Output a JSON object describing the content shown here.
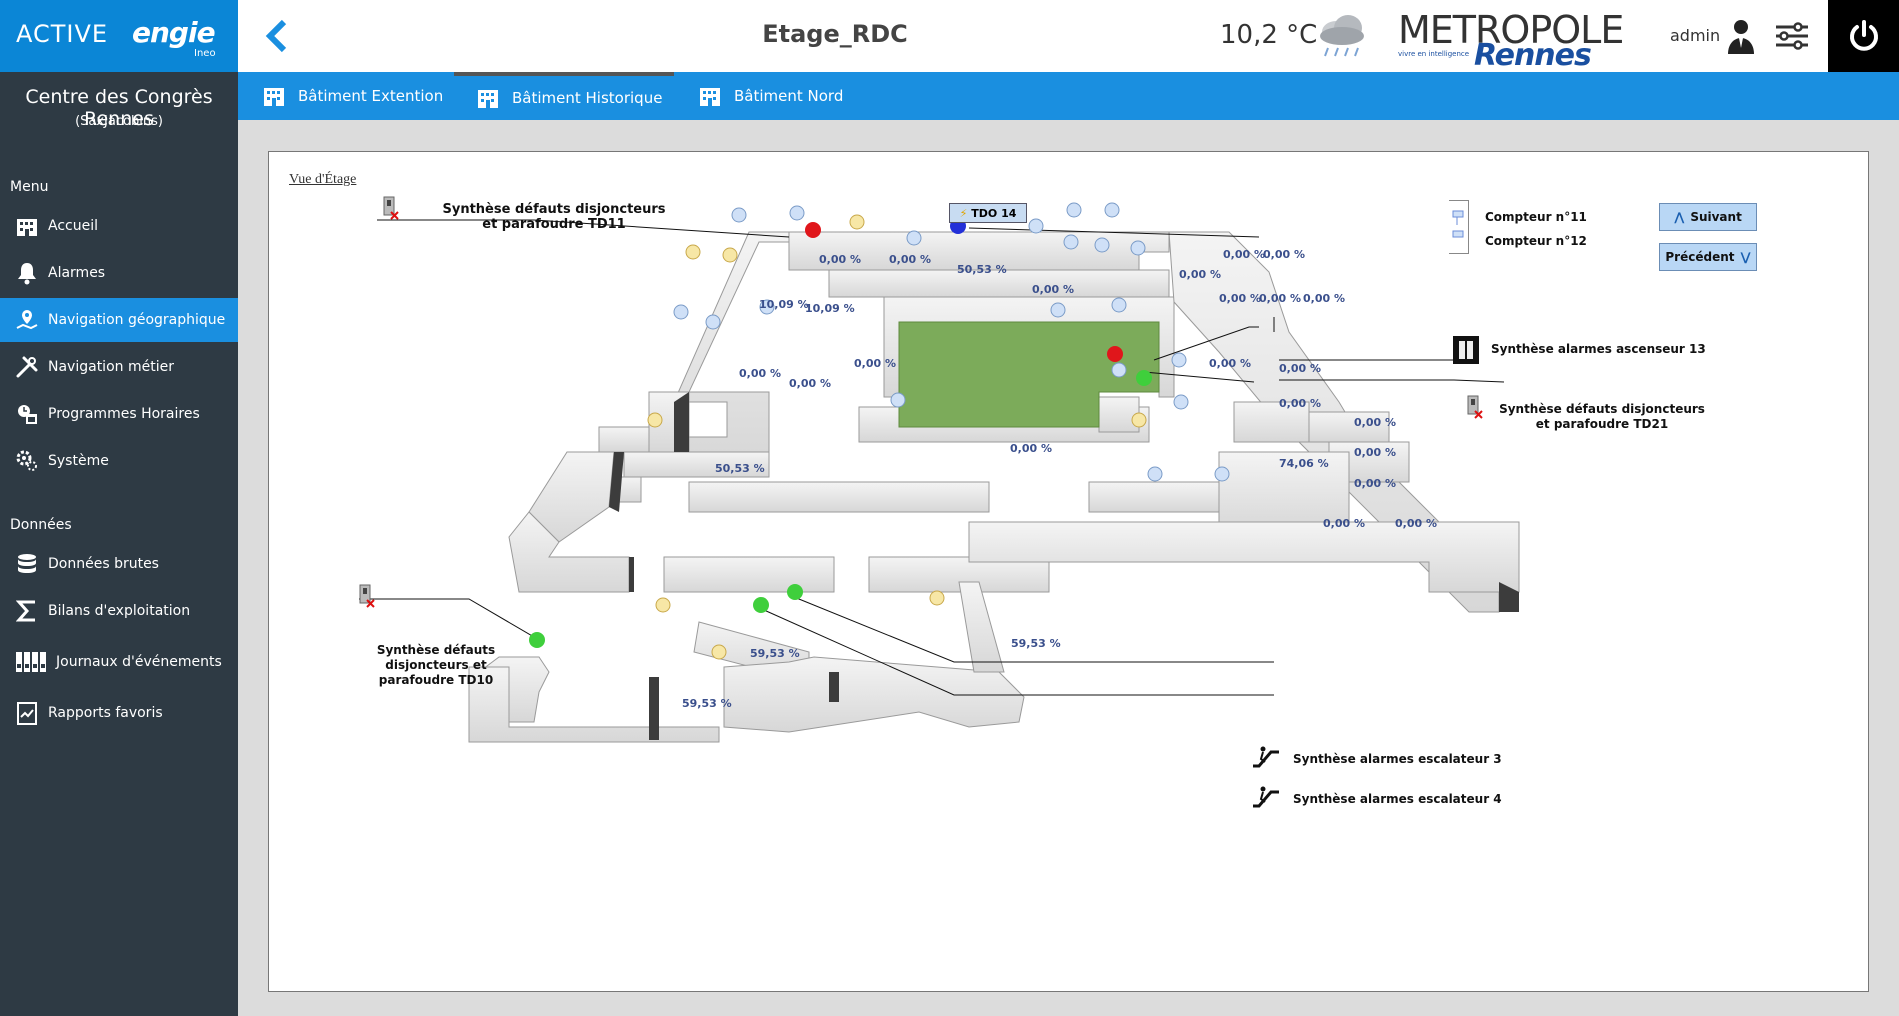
{
  "brand": {
    "active": "ACTIVE",
    "engie": "engie",
    "ineo": "Ineo"
  },
  "site": {
    "name": "Centre des Congrès Rennes",
    "sub": "(SaxJacobins)"
  },
  "sidebar": {
    "menu_title": "Menu",
    "menu": [
      {
        "label": "Accueil",
        "icon": "building-icon"
      },
      {
        "label": "Alarmes",
        "icon": "bell-icon"
      },
      {
        "label": "Navigation géographique",
        "icon": "map-pin-icon",
        "active": true
      },
      {
        "label": "Navigation métier",
        "icon": "tools-icon"
      },
      {
        "label": "Programmes Horaires",
        "icon": "clock-icon"
      },
      {
        "label": "Système",
        "icon": "gear-icon"
      }
    ],
    "data_title": "Données",
    "data": [
      {
        "label": "Données brutes",
        "icon": "database-icon"
      },
      {
        "label": "Bilans d'exploitation",
        "icon": "sigma-icon"
      },
      {
        "label": "Journaux d'événements",
        "icon": "binders-icon"
      },
      {
        "label": "Rapports favoris",
        "icon": "report-icon"
      }
    ]
  },
  "header": {
    "title": "Etage_RDC",
    "temperature": "10,2 °C",
    "metro_top": "METROPOLE",
    "metro_bottom": "Rennes",
    "metro_tag": "vivre en intelligence",
    "user": "admin"
  },
  "tabs": [
    {
      "label": "Bâtiment Extention",
      "active": false
    },
    {
      "label": "Bâtiment Historique",
      "active": true
    },
    {
      "label": "Bâtiment Nord",
      "active": false
    }
  ],
  "panel": {
    "view_link": "Vue d'Étage",
    "tdo": "TDO 14",
    "labels": {
      "td11": "Synthèse défauts disjoncteurs et parafoudre TD11",
      "compteur11": "Compteur n°11",
      "compteur12": "Compteur n°12",
      "suivant": "Suivant",
      "precedent": "Précédent",
      "ascenseur13": "Synthèse alarmes ascenseur 13",
      "td21": "Synthèse défauts disjoncteurs et parafoudre TD21",
      "td10": "Synthèse défauts disjoncteurs et parafoudre TD10",
      "escalateur3": "Synthèse alarmes escalateur 3",
      "escalateur4": "Synthèse alarmes escalateur 4"
    },
    "percents": [
      "0,00 %",
      "0,00 %",
      "50,53 %",
      "0,00 %",
      "0,00 %",
      "0,00 %",
      "0,00 %",
      "10,09 %",
      "10,09 %",
      "0,00 %",
      "0,00 %",
      "0,00 %",
      "0,00 %",
      "0,00 %",
      "0,00 %",
      "0,00 %",
      "0,00 %",
      "0,00 %",
      "0,00 %",
      "50,53 %",
      "0,00 %",
      "74,06 %",
      "0,00 %",
      "0,00 %",
      "0,00 %",
      "0,00 %",
      "59,53 %",
      "59,53 %",
      "59,53 %"
    ]
  },
  "colors": {
    "accent": "#1a8fe0",
    "sidebar": "#2e3a44",
    "brand": "#0b86d6",
    "alarm_red": "#e0161b",
    "ok_green": "#3fcf3c",
    "info_blue": "#2330d8",
    "lawn": "#7cab5a"
  }
}
